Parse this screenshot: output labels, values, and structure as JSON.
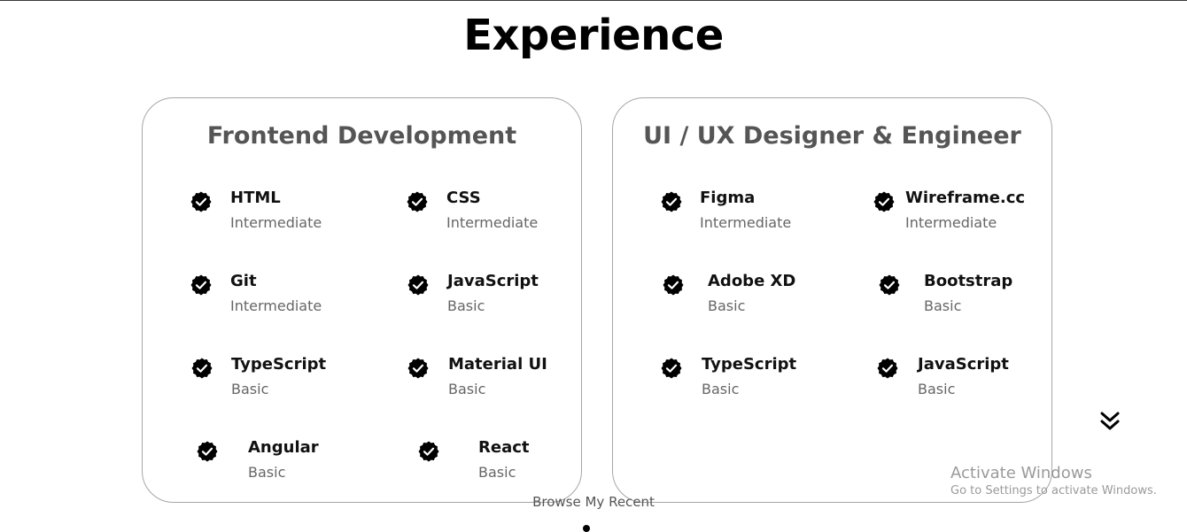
{
  "page": {
    "title": "Experience",
    "browse_text": "Browse My Recent"
  },
  "cards": [
    {
      "title": "Frontend Development",
      "skills": [
        {
          "name": "HTML",
          "level": "Intermediate"
        },
        {
          "name": "CSS",
          "level": "Intermediate"
        },
        {
          "name": "Git",
          "level": "Intermediate"
        },
        {
          "name": "JavaScript",
          "level": "Basic"
        },
        {
          "name": "TypeScript",
          "level": "Basic"
        },
        {
          "name": "Material UI",
          "level": "Basic"
        },
        {
          "name": "Angular",
          "level": "Basic"
        },
        {
          "name": "React",
          "level": "Basic"
        }
      ]
    },
    {
      "title": "UI / UX Designer & Engineer",
      "skills": [
        {
          "name": "Figma",
          "level": "Intermediate"
        },
        {
          "name": "Wireframe.cc",
          "level": "Intermediate"
        },
        {
          "name": "Adobe XD",
          "level": "Basic"
        },
        {
          "name": "Bootstrap",
          "level": "Basic"
        },
        {
          "name": "TypeScript",
          "level": "Basic"
        },
        {
          "name": "JavaScript",
          "level": "Basic"
        }
      ]
    }
  ],
  "icons": {
    "skill_badge": "checkmark-badge-icon",
    "scroll": "double-chevron-down-icon"
  },
  "watermark": {
    "title": "Activate Windows",
    "subtitle": "Go to Settings to activate Windows."
  },
  "colors": {
    "background": "#ffffff",
    "card_border": "#a6a6a6",
    "card_title": "#555555",
    "text_muted": "#666666"
  }
}
